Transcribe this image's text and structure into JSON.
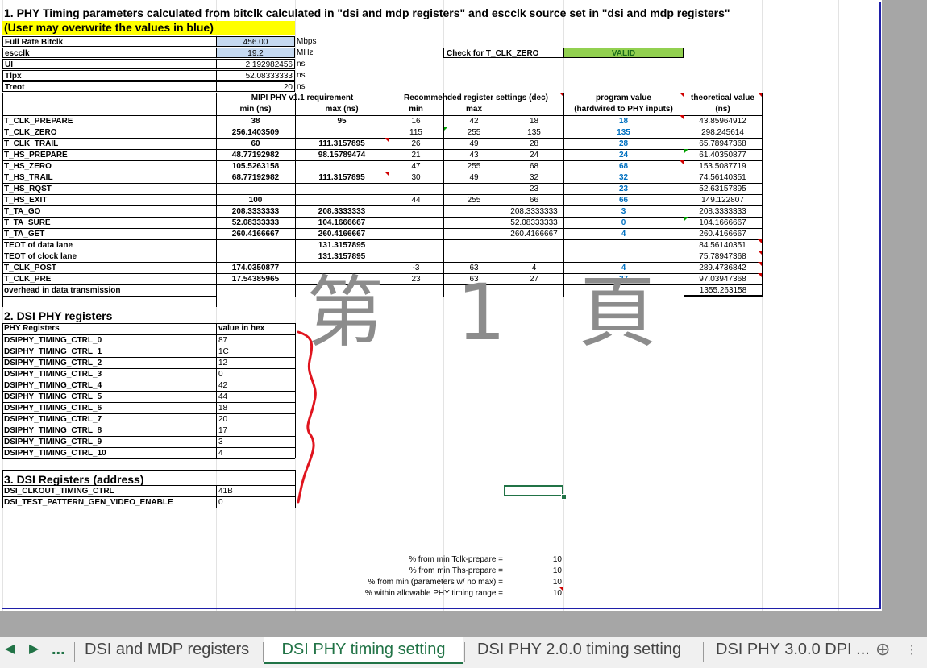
{
  "title1": "1. PHY Timing parameters calculated from bitclk calculated in \"dsi and mdp registers\" and escclk source set in \"dsi and mdp registers\"",
  "title2": "(User may overwrite the values in blue)",
  "params": [
    {
      "label": "Full Rate Bitclk",
      "value": "456.00",
      "unit": "Mbps",
      "input": true
    },
    {
      "label": "escclk",
      "value": "19.2",
      "unit": "MHz",
      "input": true
    },
    {
      "label": "UI",
      "value": "2.192982456",
      "unit": "ns",
      "input": false
    },
    {
      "label": "Tlpx",
      "value": "52.08333333",
      "unit": "ns",
      "input": false
    },
    {
      "label": "Treot",
      "value": "20",
      "unit": "ns",
      "input": false
    }
  ],
  "check": {
    "label": "Check for T_CLK_ZERO",
    "value": "VALID"
  },
  "headers": {
    "mipi": "MIPI PHY v1.1 requirement",
    "min": "min (ns)",
    "max": "max (ns)",
    "rec": "Recommended register settings (dec)",
    "rec_min": "min",
    "rec_max": "max",
    "prog1": "program value",
    "prog2": "(hardwired to PHY inputs)",
    "theo1": "theoretical value",
    "theo2": "(ns)"
  },
  "rows": [
    {
      "name": "T_CLK_PREPARE",
      "min": "38",
      "max": "95",
      "rmin": "16",
      "rmax": "42",
      "rset": "18",
      "prog": "18",
      "theo": "43.85964912"
    },
    {
      "name": "T_CLK_ZERO",
      "min": "256.1403509",
      "max": "",
      "rmin": "115",
      "rmax": "255",
      "rset": "135",
      "prog": "135",
      "theo": "298.245614"
    },
    {
      "name": "T_CLK_TRAIL",
      "min": "60",
      "max": "111.3157895",
      "rmin": "26",
      "rmax": "49",
      "rset": "28",
      "prog": "28",
      "theo": "65.78947368"
    },
    {
      "name": "T_HS_PREPARE",
      "min": "48.77192982",
      "max": "98.15789474",
      "rmin": "21",
      "rmax": "43",
      "rset": "24",
      "prog": "24",
      "theo": "61.40350877"
    },
    {
      "name": "T_HS_ZERO",
      "min": "105.5263158",
      "max": "",
      "rmin": "47",
      "rmax": "255",
      "rset": "68",
      "prog": "68",
      "theo": "153.5087719"
    },
    {
      "name": "T_HS_TRAIL",
      "min": "68.77192982",
      "max": "111.3157895",
      "rmin": "30",
      "rmax": "49",
      "rset": "32",
      "prog": "32",
      "theo": "74.56140351"
    },
    {
      "name": "T_HS_RQST",
      "min": "",
      "max": "",
      "rmin": "",
      "rmax": "",
      "rset": "23",
      "prog": "23",
      "theo": "52.63157895"
    },
    {
      "name": "T_HS_EXIT",
      "min": "100",
      "max": "",
      "rmin": "44",
      "rmax": "255",
      "rset": "66",
      "prog": "66",
      "theo": "149.122807"
    },
    {
      "name": "T_TA_GO",
      "min": "208.3333333",
      "max": "208.3333333",
      "rmin": "",
      "rmax": "",
      "rset": "208.3333333",
      "prog": "3",
      "theo": "208.3333333"
    },
    {
      "name": "T_TA_SURE",
      "min": "52.08333333",
      "max": "104.1666667",
      "rmin": "",
      "rmax": "",
      "rset": "52.08333333",
      "prog": "0",
      "theo": "104.1666667"
    },
    {
      "name": "T_TA_GET",
      "min": "260.4166667",
      "max": "260.4166667",
      "rmin": "",
      "rmax": "",
      "rset": "260.4166667",
      "prog": "4",
      "theo": "260.4166667"
    },
    {
      "name": "TEOT of data lane",
      "min": "",
      "max": "131.3157895",
      "rmin": "",
      "rmax": "",
      "rset": "",
      "prog": "",
      "theo": "84.56140351"
    },
    {
      "name": "TEOT of clock lane",
      "min": "",
      "max": "131.3157895",
      "rmin": "",
      "rmax": "",
      "rset": "",
      "prog": "",
      "theo": "75.78947368"
    },
    {
      "name": "T_CLK_POST",
      "min": "174.0350877",
      "max": "",
      "rmin": "-3",
      "rmax": "63",
      "rset": "4",
      "prog": "4",
      "theo": "289.4736842"
    },
    {
      "name": "T_CLK_PRE",
      "min": "17.54385965",
      "max": "",
      "rmin": "23",
      "rmax": "63",
      "rset": "27",
      "prog": "27",
      "theo": "97.03947368"
    },
    {
      "name": "overhead in data transmission",
      "min": "",
      "max": "",
      "rmin": "",
      "rmax": "",
      "rset": "",
      "prog": "",
      "theo": "1355.263158"
    }
  ],
  "section2": {
    "title": "2. DSI PHY registers",
    "col1": "PHY Registers",
    "col2": "value in hex",
    "regs": [
      {
        "name": "DSIPHY_TIMING_CTRL_0",
        "value": "87"
      },
      {
        "name": "DSIPHY_TIMING_CTRL_1",
        "value": "1C"
      },
      {
        "name": "DSIPHY_TIMING_CTRL_2",
        "value": "12"
      },
      {
        "name": "DSIPHY_TIMING_CTRL_3",
        "value": "0"
      },
      {
        "name": "DSIPHY_TIMING_CTRL_4",
        "value": "42"
      },
      {
        "name": "DSIPHY_TIMING_CTRL_5",
        "value": "44"
      },
      {
        "name": "DSIPHY_TIMING_CTRL_6",
        "value": "18"
      },
      {
        "name": "DSIPHY_TIMING_CTRL_7",
        "value": "20"
      },
      {
        "name": "DSIPHY_TIMING_CTRL_8",
        "value": "17"
      },
      {
        "name": "DSIPHY_TIMING_CTRL_9",
        "value": "3"
      },
      {
        "name": "DSIPHY_TIMING_CTRL_10",
        "value": "4"
      }
    ]
  },
  "section3": {
    "title": "3. DSI Registers (address)",
    "regs": [
      {
        "name": "DSI_CLKOUT_TIMING_CTRL",
        "value": "41B"
      },
      {
        "name": "DSI_TEST_PATTERN_GEN_VIDEO_ENABLE",
        "value": "0"
      }
    ]
  },
  "percents": [
    {
      "label": "% from min Tclk-prepare =",
      "value": "10"
    },
    {
      "label": "% from min Ths-prepare =",
      "value": "10"
    },
    {
      "label": "% from min (parameters w/ no max) =",
      "value": "10"
    },
    {
      "label": "% within allowable PHY timing range =",
      "value": "10"
    }
  ],
  "watermark": "第 1 頁",
  "tabs": {
    "more": "...",
    "items": [
      "DSI and MDP registers",
      "DSI PHY timing setting",
      "DSI PHY 2.0.0 timing setting",
      "DSI PHY 3.0.0 DPI ..."
    ],
    "active": 1
  },
  "colors": {
    "accent": "#217346",
    "input_fill": "#c5d9f1",
    "valid_fill": "#92d050",
    "highlight": "#ffff00",
    "prog_blue": "#0070c0"
  }
}
